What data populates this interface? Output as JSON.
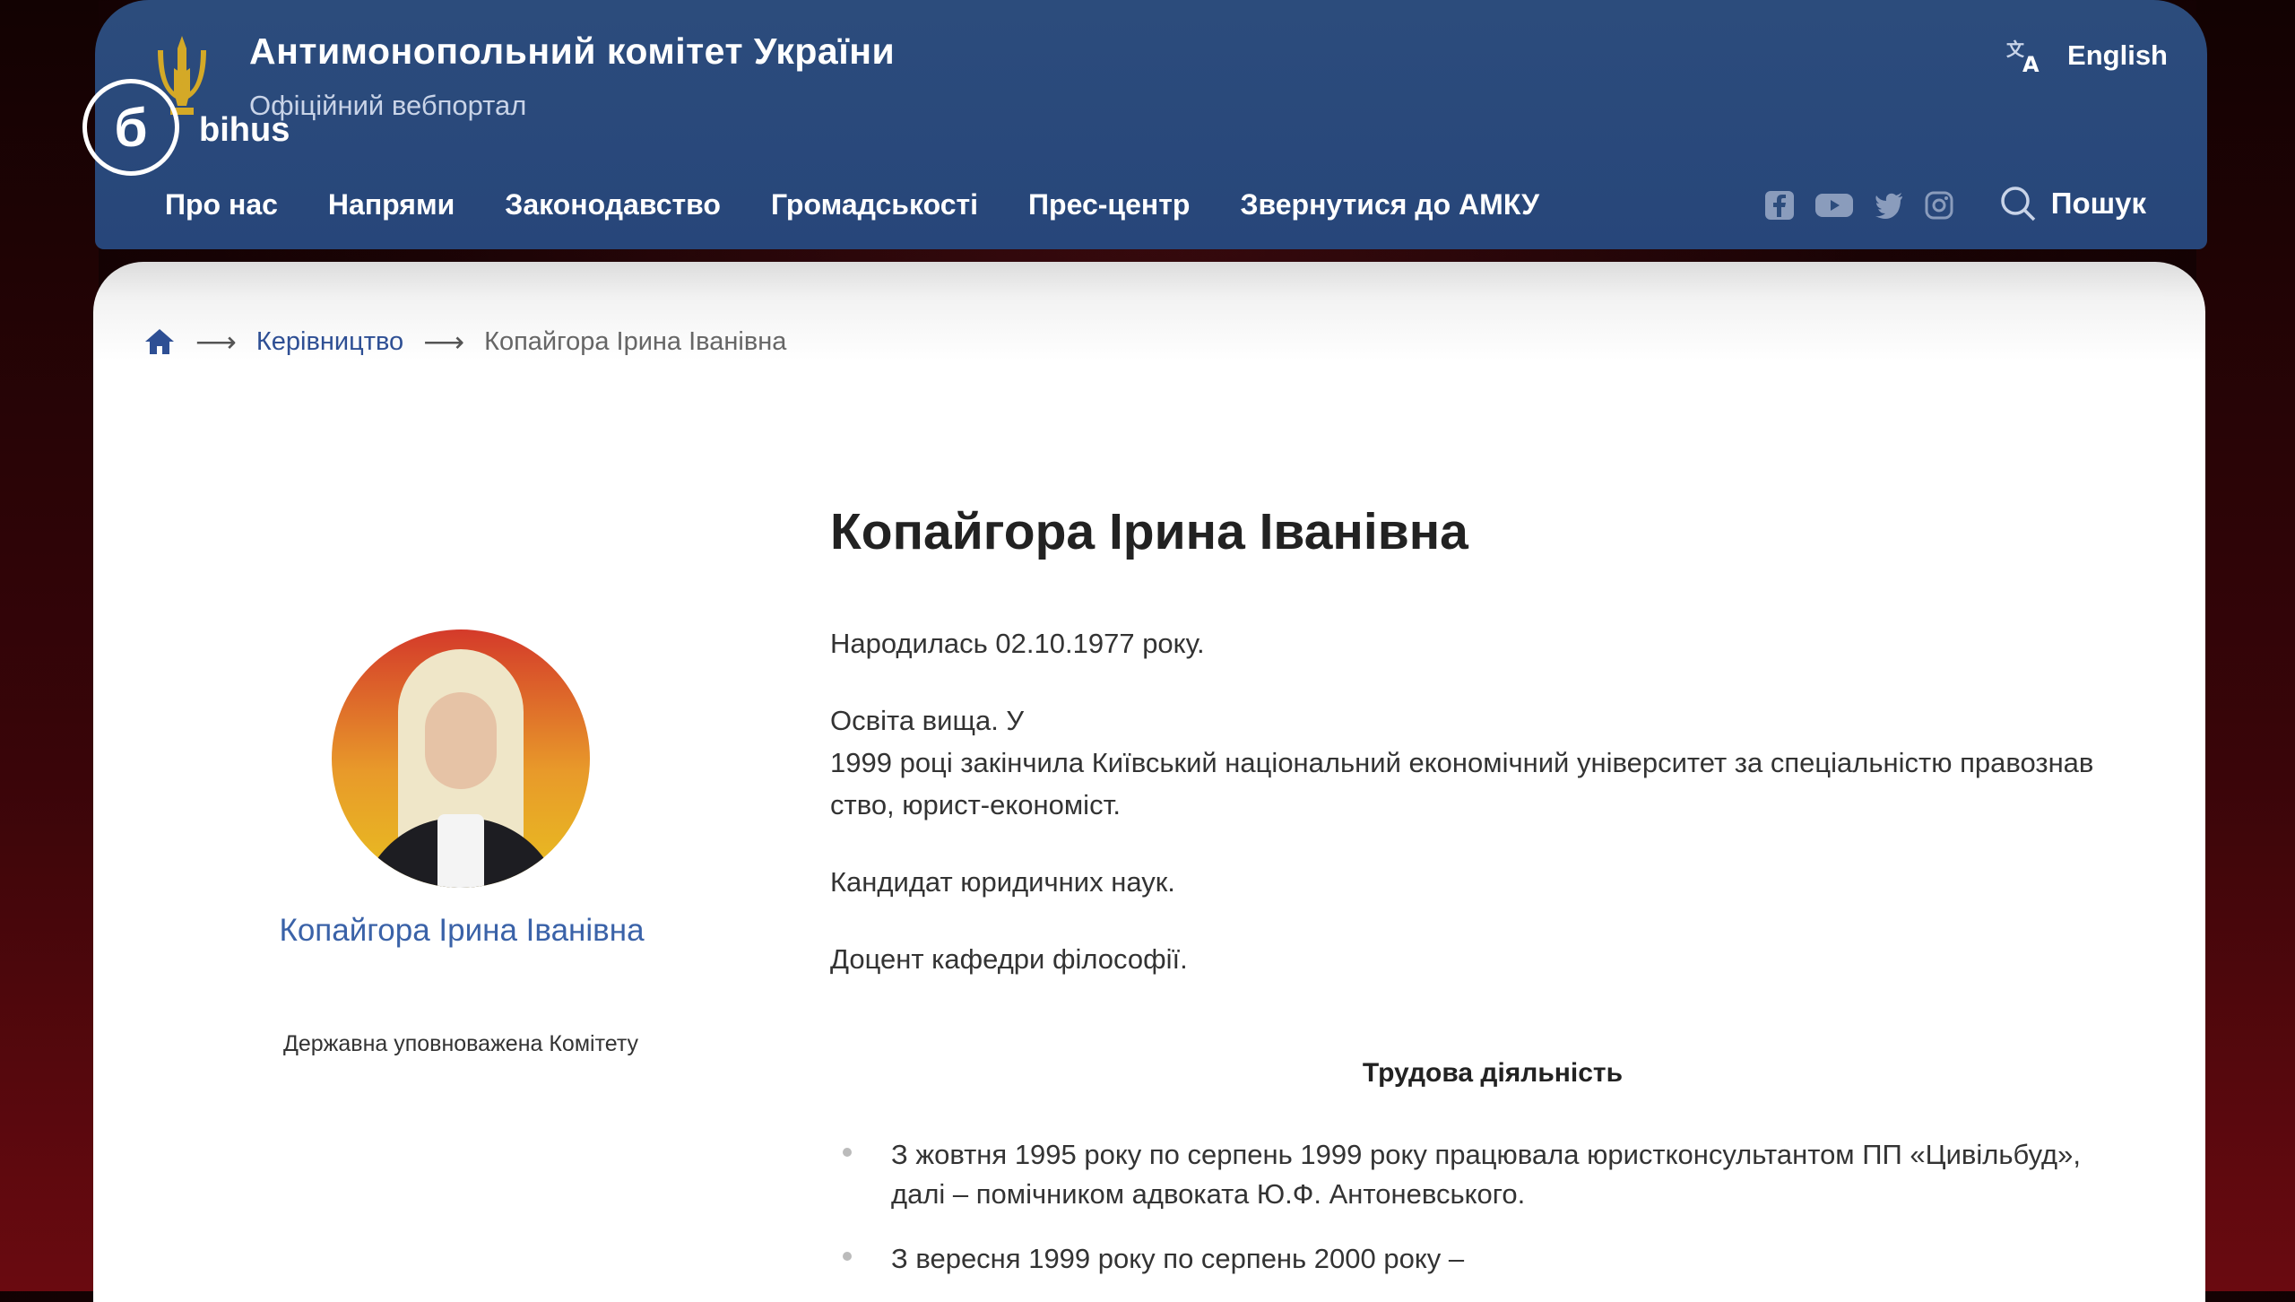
{
  "header": {
    "site_title": "Антимонопольний комітет України",
    "site_subtitle": "Офіційний вебпортал",
    "language": "English",
    "search_label": "Пошук"
  },
  "watermark": {
    "mark": "б",
    "text": "bihus"
  },
  "nav": [
    "Про нас",
    "Напрями",
    "Законодавство",
    "Громадськості",
    "Прес-центр",
    "Звернутися до АМКУ"
  ],
  "socials": [
    "facebook-icon",
    "youtube-icon",
    "twitter-icon",
    "instagram-icon"
  ],
  "breadcrumb": {
    "parent": "Керівництво",
    "current": "Копайгора Ірина Іванівна"
  },
  "profile": {
    "name": "Копайгора Ірина Іванівна",
    "role": "Державна уповноважена Комітету"
  },
  "bio": {
    "title": "Копайгора Ірина Іванівна",
    "born": "Народилась 02.10.1977 року.",
    "education_1": "Освіта вища. У",
    "education_2": "1999 році закінчила Київський національний економічний університет за спеціальністю правознав",
    "education_3": "ство, юрист-економіст.",
    "degree": "Кандидат юридичних наук.",
    "docent": "Доцент кафедри філософії.",
    "career_heading": "Трудова діяльність",
    "career_1a": "З жовтня 1995 року по серпень 1999 року працювала юристконсультантом ПП «Цивільбуд»,",
    "career_1b": "далі – помічником адвоката Ю.Ф. Антоневського.",
    "career_2a": "З вересня 1999 року по серпень 2000 року –"
  },
  "colors": {
    "header_bg": "#2c4c7c",
    "link": "#3a62a8",
    "accent_gold": "#d4a927"
  }
}
